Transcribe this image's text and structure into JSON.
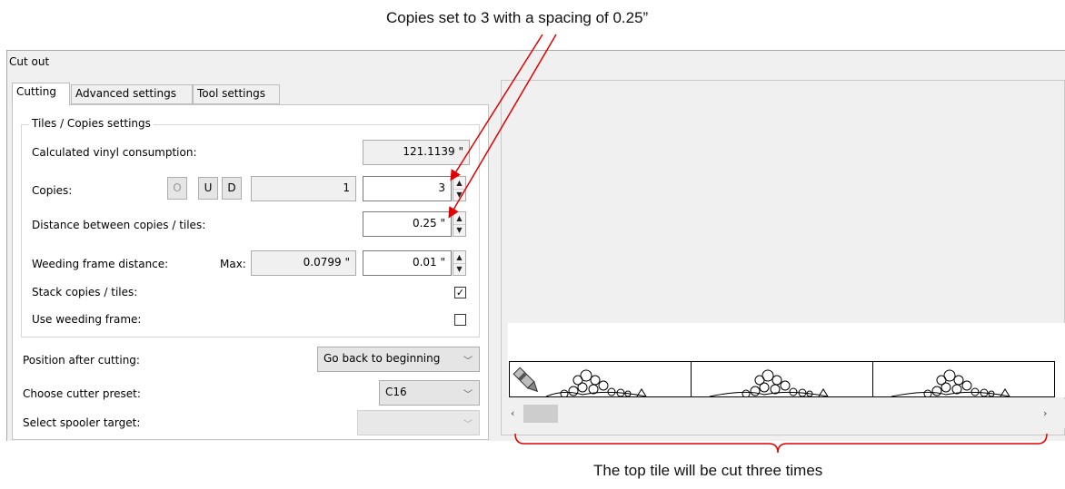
{
  "annotations": {
    "top": "Copies set to 3 with a spacing of 0.25”",
    "bottom": "The top tile will be cut three times"
  },
  "window": {
    "title": "Cut out"
  },
  "tabs": [
    {
      "label": "Cutting",
      "active": true
    },
    {
      "label": "Advanced settings",
      "active": false
    },
    {
      "label": "Tool settings",
      "active": false
    }
  ],
  "tiles_group": {
    "title": "Tiles / Copies settings",
    "vinyl_label": "Calculated vinyl consumption:",
    "vinyl_value": "121.1139 \"",
    "copies_label": "Copies:",
    "buttons": {
      "o": "O",
      "u": "U",
      "d": "D"
    },
    "copies_readonly": "1",
    "copies_value": "3",
    "distance_label": "Distance between copies / tiles:",
    "distance_value": "0.25 \"",
    "weeding_label": "Weeding frame distance:",
    "max_label": "Max:",
    "max_value": "0.0799 \"",
    "weeding_value": "0.01 \"",
    "stack_label": "Stack copies / tiles:",
    "stack_checked": true,
    "use_weeding_label": "Use weeding frame:",
    "use_weeding_checked": false
  },
  "position_label": "Position after cutting:",
  "position_value": "Go back to beginning",
  "preset_label": "Choose cutter preset:",
  "preset_value": "C16",
  "spooler_label": "Select spooler target:",
  "spooler_value": "",
  "preview": {
    "tile_count": 3
  },
  "colors": {
    "annotation_red": "#e00000"
  }
}
